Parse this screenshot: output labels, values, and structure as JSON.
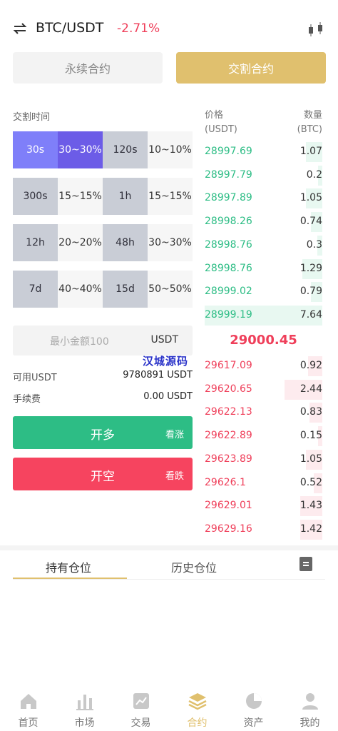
{
  "header": {
    "pair": "BTC/USDT",
    "change": "-2.71%",
    "change_color": "#ef3f5a",
    "left_icon": "swap-icon",
    "right_icon": "kline-icon"
  },
  "contract_tabs": {
    "perpetual": "永续合约",
    "delivery": "交割合约",
    "active": "delivery",
    "accent": "#e0c06e"
  },
  "settlement": {
    "label": "交割时间",
    "options": [
      {
        "time": "30s",
        "range": "30~30%",
        "selected": true
      },
      {
        "time": "120s",
        "range": "10~10%",
        "selected": false
      },
      {
        "time": "300s",
        "range": "15~15%",
        "selected": false
      },
      {
        "time": "1h",
        "range": "15~15%",
        "selected": false
      },
      {
        "time": "12h",
        "range": "20~20%",
        "selected": false
      },
      {
        "time": "48h",
        "range": "30~30%",
        "selected": false
      },
      {
        "time": "7d",
        "range": "40~40%",
        "selected": false
      },
      {
        "time": "15d",
        "range": "50~50%",
        "selected": false
      }
    ]
  },
  "amount": {
    "placeholder": "最小金额100",
    "unit": "USDT"
  },
  "watermark": "汉城源码",
  "available": {
    "label": "可用USDT",
    "value": "9780891 USDT"
  },
  "fee": {
    "label": "手续费",
    "value": "0.00 USDT"
  },
  "buttons": {
    "long_label": "开多",
    "long_sub": "看涨",
    "long_color": "#2dbd85",
    "short_label": "开空",
    "short_sub": "看跌",
    "short_color": "#f6445f"
  },
  "orderbook": {
    "price_header": "价格",
    "price_unit": "(USDT)",
    "qty_header": "数量",
    "qty_unit": "(BTC)",
    "buys": [
      {
        "price": "28997.69",
        "qty": "1.07",
        "depth": 0.14
      },
      {
        "price": "28997.79",
        "qty": "0.2",
        "depth": 0.03
      },
      {
        "price": "28997.89",
        "qty": "1.05",
        "depth": 0.14
      },
      {
        "price": "28998.26",
        "qty": "0.74",
        "depth": 0.1
      },
      {
        "price": "28998.76",
        "qty": "0.3",
        "depth": 0.04
      },
      {
        "price": "28998.76",
        "qty": "1.29",
        "depth": 0.17
      },
      {
        "price": "28999.02",
        "qty": "0.79",
        "depth": 0.1
      },
      {
        "price": "28999.19",
        "qty": "7.64",
        "depth": 1.0
      }
    ],
    "last_price": "29000.45",
    "sells": [
      {
        "price": "29617.09",
        "qty": "0.92",
        "depth": 0.12
      },
      {
        "price": "29620.65",
        "qty": "2.44",
        "depth": 0.32
      },
      {
        "price": "29622.13",
        "qty": "0.83",
        "depth": 0.11
      },
      {
        "price": "29622.89",
        "qty": "0.15",
        "depth": 0.02
      },
      {
        "price": "29623.89",
        "qty": "1.05",
        "depth": 0.14
      },
      {
        "price": "29626.1",
        "qty": "0.52",
        "depth": 0.07
      },
      {
        "price": "29629.01",
        "qty": "1.43",
        "depth": 0.19
      },
      {
        "price": "29629.16",
        "qty": "1.42",
        "depth": 0.19
      }
    ]
  },
  "position_tabs": {
    "holding": "持有仓位",
    "history": "历史仓位",
    "icon": "document-icon"
  },
  "nav": {
    "items": [
      {
        "label": "首页",
        "icon": "home-icon",
        "active": false
      },
      {
        "label": "市场",
        "icon": "market-icon",
        "active": false
      },
      {
        "label": "交易",
        "icon": "trade-icon",
        "active": false
      },
      {
        "label": "合约",
        "icon": "contract-icon",
        "active": true
      },
      {
        "label": "资产",
        "icon": "assets-icon",
        "active": false
      },
      {
        "label": "我的",
        "icon": "profile-icon",
        "active": false
      }
    ],
    "active_color": "#e0c06e",
    "inactive_color": "#c8c8c8"
  }
}
